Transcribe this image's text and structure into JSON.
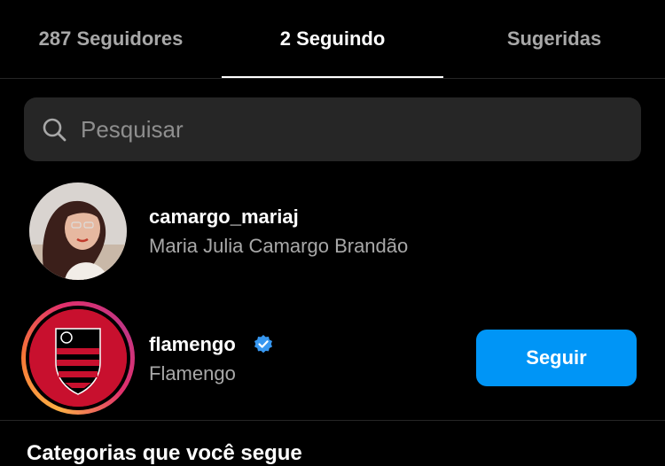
{
  "tabs": [
    {
      "label": "287 Seguidores"
    },
    {
      "label": "2 Seguindo"
    },
    {
      "label": "Sugeridas"
    }
  ],
  "active_tab": "2 Seguindo",
  "search": {
    "placeholder": "Pesquisar",
    "value": ""
  },
  "accounts": [
    {
      "username": "camargo_mariaj",
      "full_name": "Maria Julia Camargo Brandão",
      "verified": false,
      "has_story_ring": false
    },
    {
      "username": "flamengo",
      "full_name": "Flamengo",
      "verified": true,
      "has_story_ring": true,
      "action_label": "Seguir"
    }
  ],
  "section_peek": "Categorias que você segue",
  "colors": {
    "background": "#000000",
    "primary_button": "#0095f6",
    "muted_text": "#a8a8a8",
    "search_bg": "#262626",
    "verified": "#0095f6"
  }
}
